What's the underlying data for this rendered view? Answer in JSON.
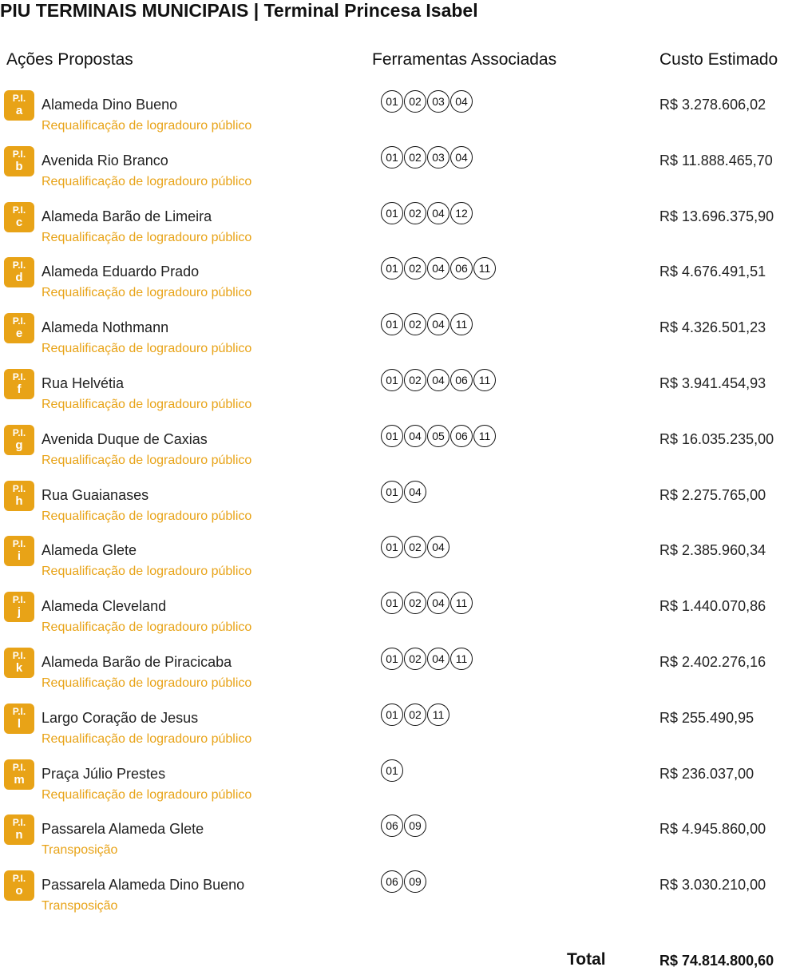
{
  "title": "PIU TERMINAIS MUNICIPAIS | Terminal Princesa Isabel",
  "headers": {
    "actions": "Ações Propostas",
    "tools": "Ferramentas Associadas",
    "cost": "Custo Estimado"
  },
  "badge_prefix": "P.I.",
  "rows": [
    {
      "letter": "a",
      "name": "Alameda Dino Bueno",
      "type": "Requalificação de logradouro público",
      "tools": [
        "01",
        "02",
        "03",
        "04"
      ],
      "cost": "R$ 3.278.606,02"
    },
    {
      "letter": "b",
      "name": "Avenida Rio Branco",
      "type": "Requalificação de logradouro público",
      "tools": [
        "01",
        "02",
        "03",
        "04"
      ],
      "cost": "R$ 11.888.465,70"
    },
    {
      "letter": "c",
      "name": "Alameda Barão de Limeira",
      "type": "Requalificação de logradouro público",
      "tools": [
        "01",
        "02",
        "04",
        "12"
      ],
      "cost": "R$ 13.696.375,90"
    },
    {
      "letter": "d",
      "name": "Alameda Eduardo Prado",
      "type": "Requalificação de logradouro público",
      "tools": [
        "01",
        "02",
        "04",
        "06",
        "11"
      ],
      "cost": "R$ 4.676.491,51"
    },
    {
      "letter": "e",
      "name": "Alameda Nothmann",
      "type": "Requalificação de logradouro público",
      "tools": [
        "01",
        "02",
        "04",
        "11"
      ],
      "cost": "R$ 4.326.501,23"
    },
    {
      "letter": "f",
      "name": "Rua Helvétia",
      "type": "Requalificação de logradouro público",
      "tools": [
        "01",
        "02",
        "04",
        "06",
        "11"
      ],
      "cost": "R$ 3.941.454,93"
    },
    {
      "letter": "g",
      "name": "Avenida Duque de Caxias",
      "type": "Requalificação de logradouro público",
      "tools": [
        "01",
        "04",
        "05",
        "06",
        "11"
      ],
      "cost": "R$ 16.035.235,00"
    },
    {
      "letter": "h",
      "name": "Rua Guaianases",
      "type": "Requalificação de logradouro público",
      "tools": [
        "01",
        "04"
      ],
      "cost": "R$ 2.275.765,00"
    },
    {
      "letter": "i",
      "name": "Alameda Glete",
      "type": "Requalificação de logradouro público",
      "tools": [
        "01",
        "02",
        "04"
      ],
      "cost": "R$ 2.385.960,34"
    },
    {
      "letter": "j",
      "name": "Alameda Cleveland",
      "type": "Requalificação de logradouro público",
      "tools": [
        "01",
        "02",
        "04",
        "11"
      ],
      "cost": "R$ 1.440.070,86"
    },
    {
      "letter": "k",
      "name": "Alameda Barão de Piracicaba",
      "type": "Requalificação de logradouro público",
      "tools": [
        "01",
        "02",
        "04",
        "11"
      ],
      "cost": "R$ 2.402.276,16"
    },
    {
      "letter": "l",
      "name": "Largo Coração de Jesus",
      "type": "Requalificação de logradouro público",
      "tools": [
        "01",
        "02",
        "11"
      ],
      "cost": "R$ 255.490,95"
    },
    {
      "letter": "m",
      "name": "Praça Júlio Prestes",
      "type": "Requalificação de logradouro público",
      "tools": [
        "01"
      ],
      "cost": "R$ 236.037,00"
    },
    {
      "letter": "n",
      "name": "Passarela Alameda Glete",
      "type": "Transposição",
      "tools": [
        "06",
        "09"
      ],
      "cost": "R$ 4.945.860,00"
    },
    {
      "letter": "o",
      "name": "Passarela Alameda Dino Bueno",
      "type": "Transposição",
      "tools": [
        "06",
        "09"
      ],
      "cost": "R$ 3.030.210,00"
    }
  ],
  "total": {
    "label": "Total",
    "value": "R$ 74.814.800,60"
  },
  "colors": {
    "accent": "#e8a317",
    "text": "#222222"
  }
}
